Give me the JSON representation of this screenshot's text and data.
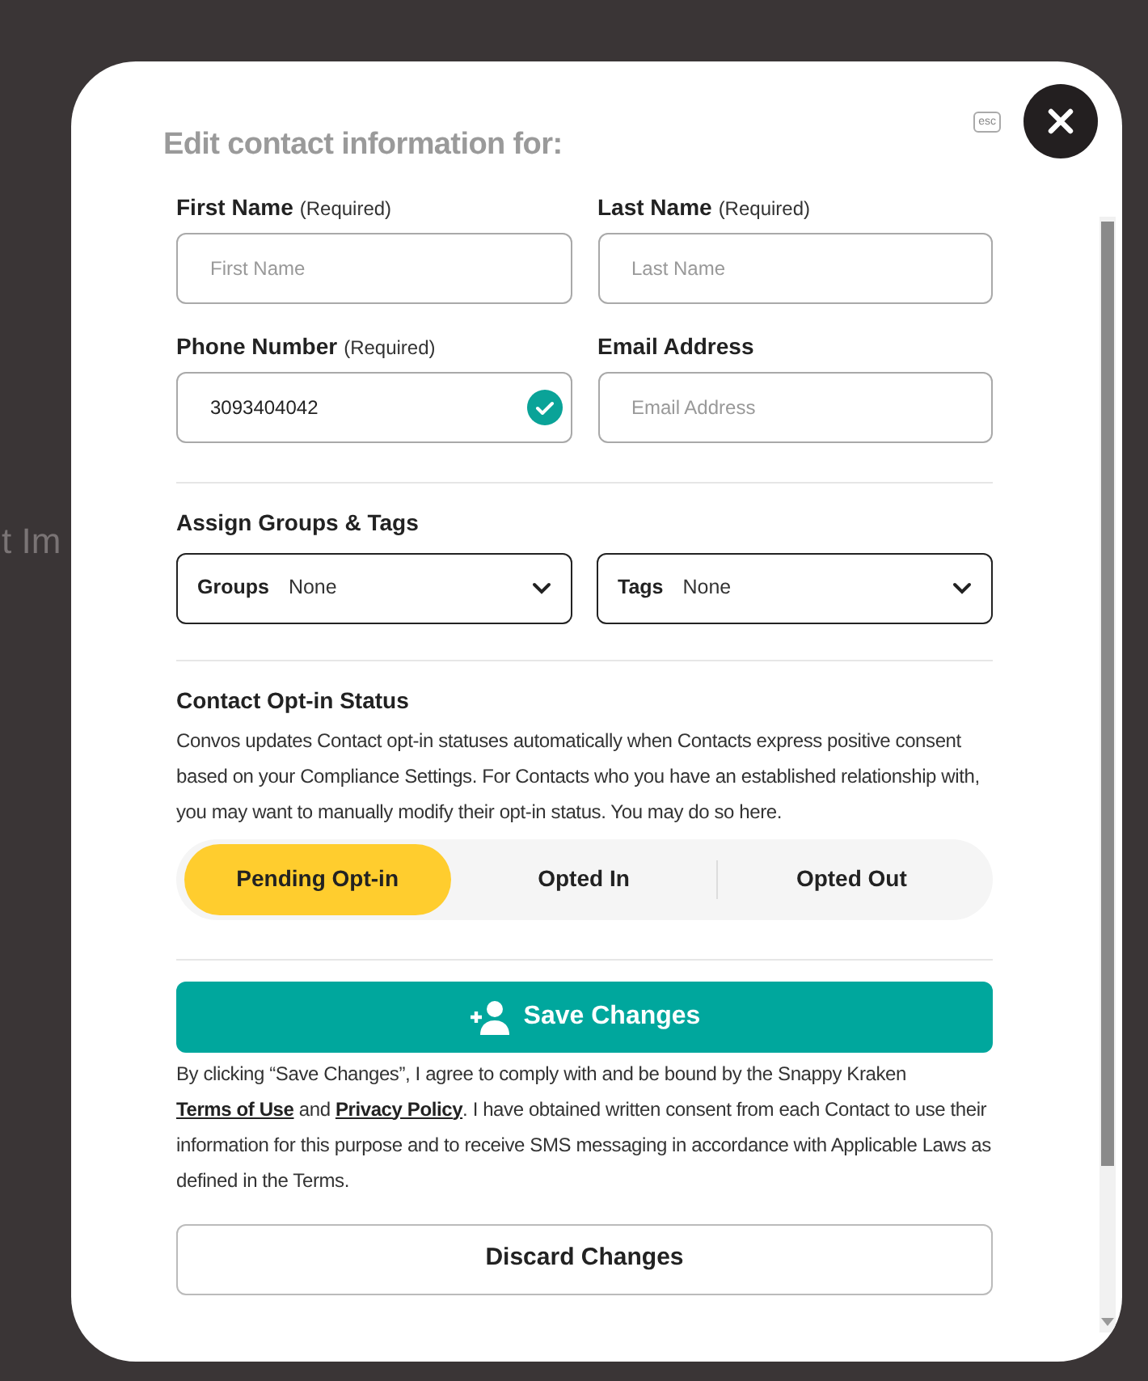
{
  "background": {
    "text": "t Im"
  },
  "dialog": {
    "title": "Edit contact information for:",
    "esc_hint": "esc"
  },
  "fields": [
    {
      "label": "First Name",
      "note": "(Required)",
      "placeholder": "First Name",
      "valid": false
    },
    {
      "label": "Last Name",
      "note": "(Required)",
      "placeholder": "Last Name",
      "valid": false
    },
    {
      "label": "Phone Number",
      "note": "(Required)",
      "value": "3093404042",
      "valid": true
    },
    {
      "label": "Email Address",
      "placeholder": "Email Address",
      "valid": false
    }
  ],
  "groups_tags": {
    "title": "Assign Groups & Tags",
    "selects": [
      {
        "label": "Groups",
        "value": "None"
      },
      {
        "label": "Tags",
        "value": "None"
      }
    ]
  },
  "opt_in": {
    "title": "Contact Opt-in Status",
    "description": "Convos updates Contact opt-in statuses automatically when Contacts express positive consent based on your Compliance Settings. For Contacts who you have an established relationship with, you may want to manually modify their opt-in status. You may do so here.",
    "options": [
      {
        "label": "Pending Opt-in",
        "selected": true
      },
      {
        "label": "Opted In",
        "selected": false
      },
      {
        "label": "Opted Out",
        "selected": false
      }
    ]
  },
  "save_button": "Save Changes",
  "agreement": {
    "before": "By clicking “Save Changes”, I agree to comply with and be bound by the Snappy Kraken",
    "link1": "Terms of Use",
    "middle": "and",
    "link2": "Privacy Policy",
    "after": ". I have obtained written consent from each Contact to use their information for this purpose and to receive SMS messaging in accordance with Applicable Laws as defined in the Terms."
  },
  "discard_button": "Discard Changes"
}
